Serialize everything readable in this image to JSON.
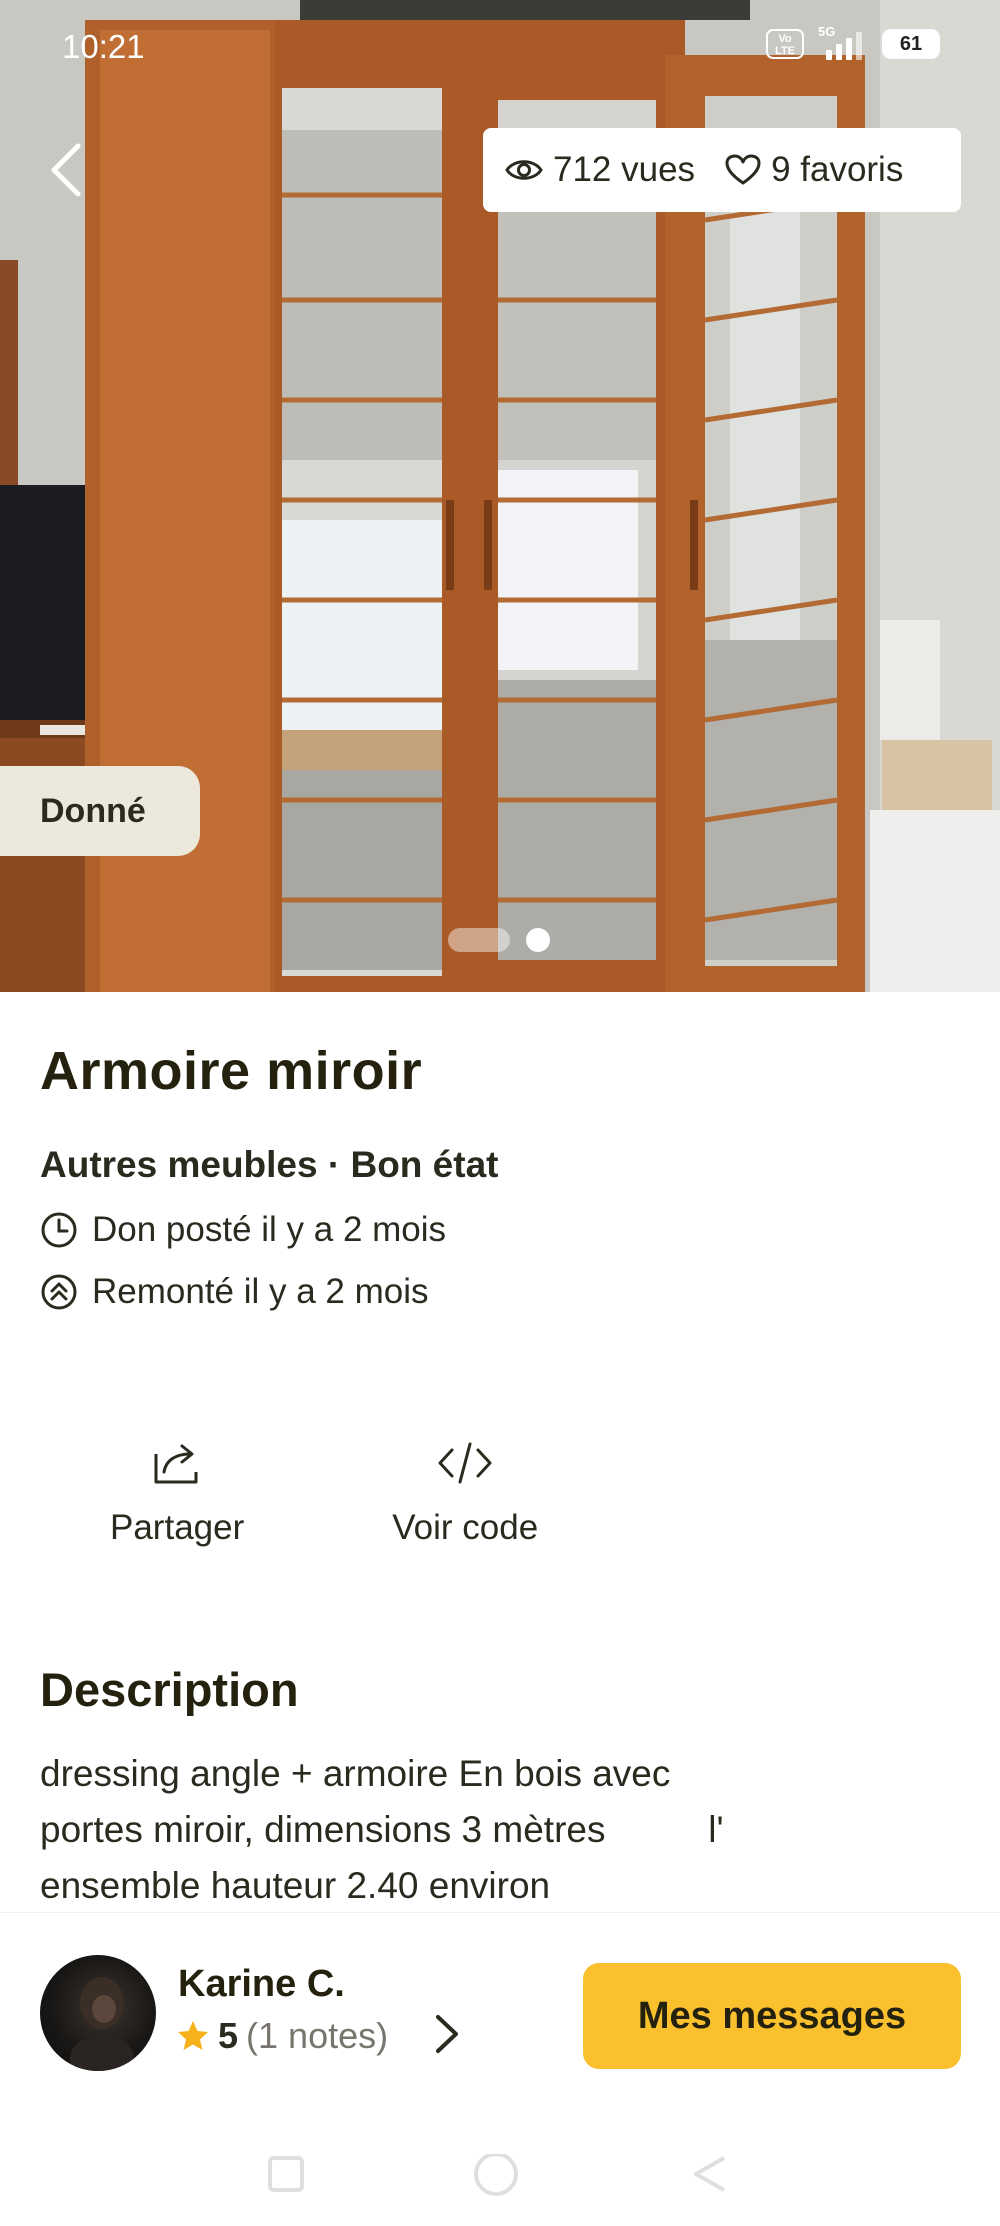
{
  "status_bar": {
    "time": "10:21",
    "network": "5G",
    "volte": "Vo LTE",
    "battery": "61"
  },
  "hero": {
    "views": "712 vues",
    "favorites": "9 favoris",
    "badge": "Donné",
    "carousel": {
      "count": 2,
      "active_index": 1
    }
  },
  "listing": {
    "title": "Armoire miroir",
    "category_condition": "Autres meubles · Bon état",
    "posted": "Don posté il y a 2 mois",
    "bumped": "Remonté il y a 2 mois"
  },
  "actions": {
    "share": "Partager",
    "code": "Voir code"
  },
  "description": {
    "heading": "Description",
    "lines": [
      "dressing angle + armoire En bois avec",
      "portes miroir, dimensions 3 mètres          l'",
      "ensemble hauteur 2.40 environ"
    ]
  },
  "seller": {
    "name": "Karine C.",
    "rating": "5",
    "rating_count": "(1 notes)"
  },
  "cta": {
    "messages": "Mes messages"
  },
  "colors": {
    "accent": "#fbc02d",
    "badge_bg": "#ece8dc",
    "text": "#2b2a1e",
    "star": "#f6b21b"
  },
  "icons": [
    "back-arrow-icon",
    "eye-icon",
    "heart-icon",
    "clock-icon",
    "bump-up-icon",
    "share-icon",
    "code-icon",
    "star-icon",
    "chevron-right-icon"
  ]
}
